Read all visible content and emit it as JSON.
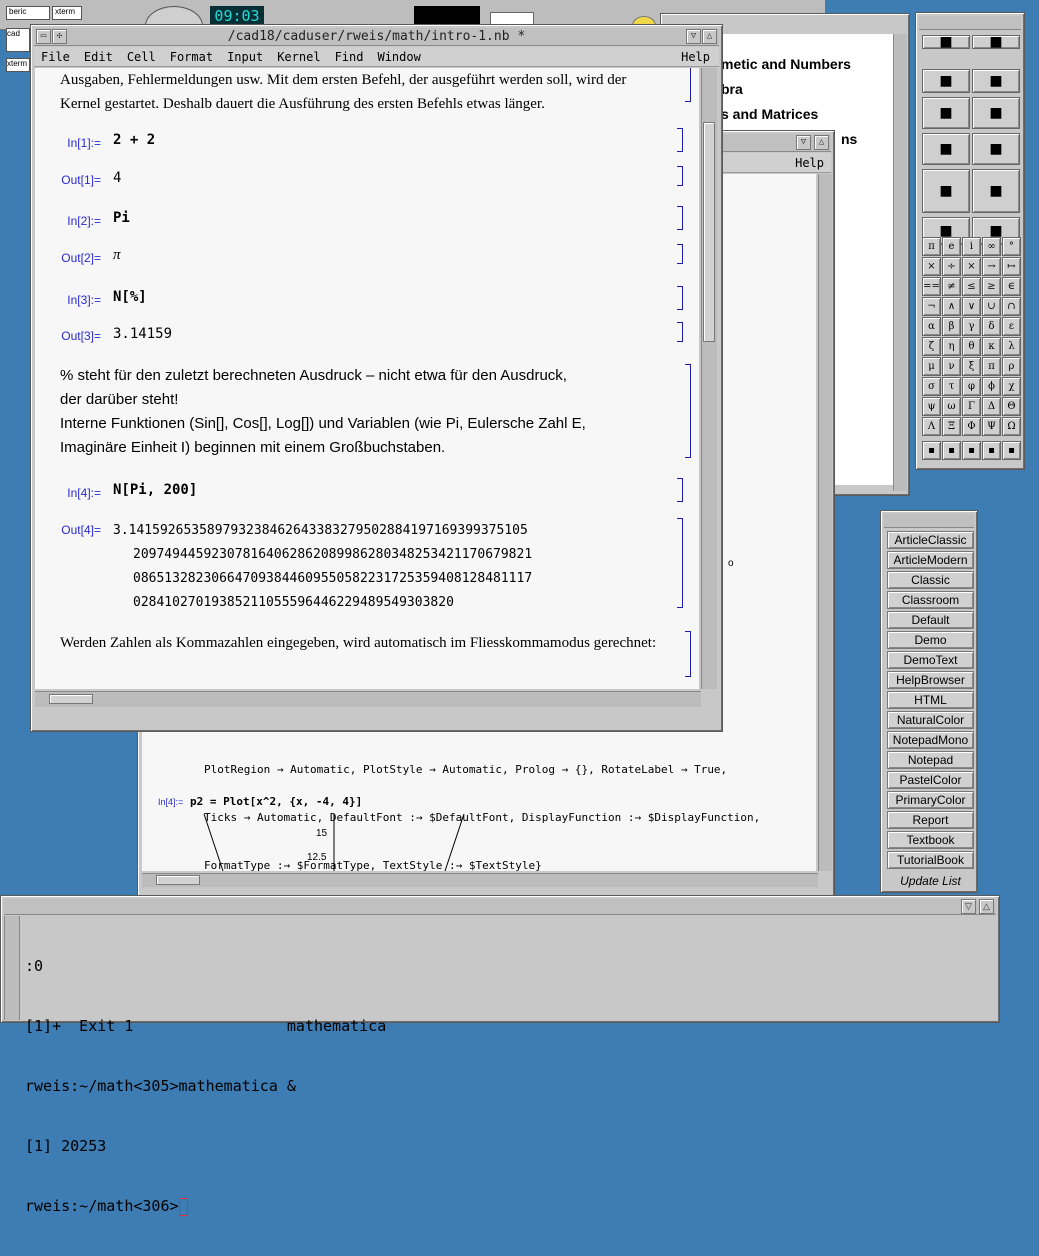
{
  "colors": {
    "desktop": "#3e7db4",
    "cell_label": "#2a2ad0",
    "bracket": "#1c1ca8"
  },
  "taskbar": {
    "clock": "09:03",
    "icons": [
      "beric",
      "xterm",
      "cad",
      "xterm"
    ]
  },
  "main_window": {
    "title": "/cad18/caduser/rweis/math/intro-1.nb *",
    "menu": [
      "File",
      "Edit",
      "Cell",
      "Format",
      "Input",
      "Kernel",
      "Find",
      "Window"
    ],
    "help": "Help",
    "intro_text": "Ausgaben, Fehlermeldungen usw. Mit dem ersten Befehl, der ausgeführt werden soll, wird der Kernel gestartet. Deshalb dauert die Ausführung des ersten Befehls etwas länger.",
    "cells": [
      {
        "label": "In[1]:=",
        "content": "2 + 2"
      },
      {
        "label": "Out[1]=",
        "content": "4"
      },
      {
        "label": "In[2]:=",
        "content": "Pi"
      },
      {
        "label": "Out[2]=",
        "content": "π"
      },
      {
        "label": "In[3]:=",
        "content": "N[%]"
      },
      {
        "label": "Out[3]=",
        "content": "3.14159"
      }
    ],
    "text_lines": [
      "% steht für den zuletzt berechneten Ausdruck – nicht etwa für den Ausdruck,",
      "der darüber steht!",
      "Interne Funktionen (Sin[], Cos[], Log[]) und Variablen (wie Pi, Eulersche Zahl E,",
      "Imaginäre Einheit I) beginnen mit einem Großbuchstaben."
    ],
    "in4_label": "In[4]:=",
    "in4": "N[Pi, 200]",
    "out4_label": "Out[4]=",
    "out4_lines": [
      "3.141592653589793238462643383279502884197169399375105",
      "209749445923078164062862089986280348253421170679821",
      "086513282306647093844609550582231725359408128481117",
      "02841027019385211055596446229489549303820"
    ],
    "end_text": "Werden Zahlen als Kommazahlen eingegeben, wird automatisch im Fliesskommamodus gerechnet:"
  },
  "help_window": {
    "items": [
      "metic and Numbers",
      "bra",
      "s and Matrices",
      "ns"
    ]
  },
  "second_window": {
    "help": "Help",
    "options": [
      "PlotRegion → Automatic, PlotStyle → Automatic, Prolog → {}, RotateLabel → True,",
      "Ticks → Automatic, DefaultFont :→ $DefaultFont, DisplayFunction :→ $DisplayFunction,",
      "FormatType :→ $FormatType, TextStyle :→ $TextStyle}"
    ],
    "in4_label": "In[4]:=",
    "in4": "p2 = Plot[x^2, {x, -4, 4}]",
    "ticks": [
      "15",
      "12.5"
    ],
    "peek": "o"
  },
  "palette": {
    "symbols": [
      "π",
      "e",
      "i",
      "∞",
      "°",
      "×",
      "÷",
      "×",
      "→",
      "↦",
      "==",
      "≠",
      "≤",
      "≥",
      "∈",
      "¬",
      "∧",
      "∨",
      "∪",
      "∩",
      "α",
      "β",
      "γ",
      "δ",
      "ε",
      "ζ",
      "η",
      "θ",
      "κ",
      "λ",
      "μ",
      "ν",
      "ξ",
      "π",
      "ρ",
      "σ",
      "τ",
      "φ",
      "ϕ",
      "χ",
      "ψ",
      "ω",
      "Γ",
      "Δ",
      "Θ",
      "Λ",
      "Ξ",
      "Φ",
      "Ψ",
      "Ω"
    ]
  },
  "styles": {
    "items": [
      "ArticleClassic",
      "ArticleModern",
      "Classic",
      "Classroom",
      "Default",
      "Demo",
      "DemoText",
      "HelpBrowser",
      "HTML",
      "NaturalColor",
      "NotepadMono",
      "Notepad",
      "PastelColor",
      "PrimaryColor",
      "Report",
      "Textbook",
      "TutorialBook"
    ],
    "update": "Update List"
  },
  "terminal": {
    "lines": [
      ":0",
      "[1]+  Exit 1                 mathematica",
      "rweis:~/math<305>mathematica &",
      "[1] 20253",
      "rweis:~/math<306>"
    ]
  }
}
